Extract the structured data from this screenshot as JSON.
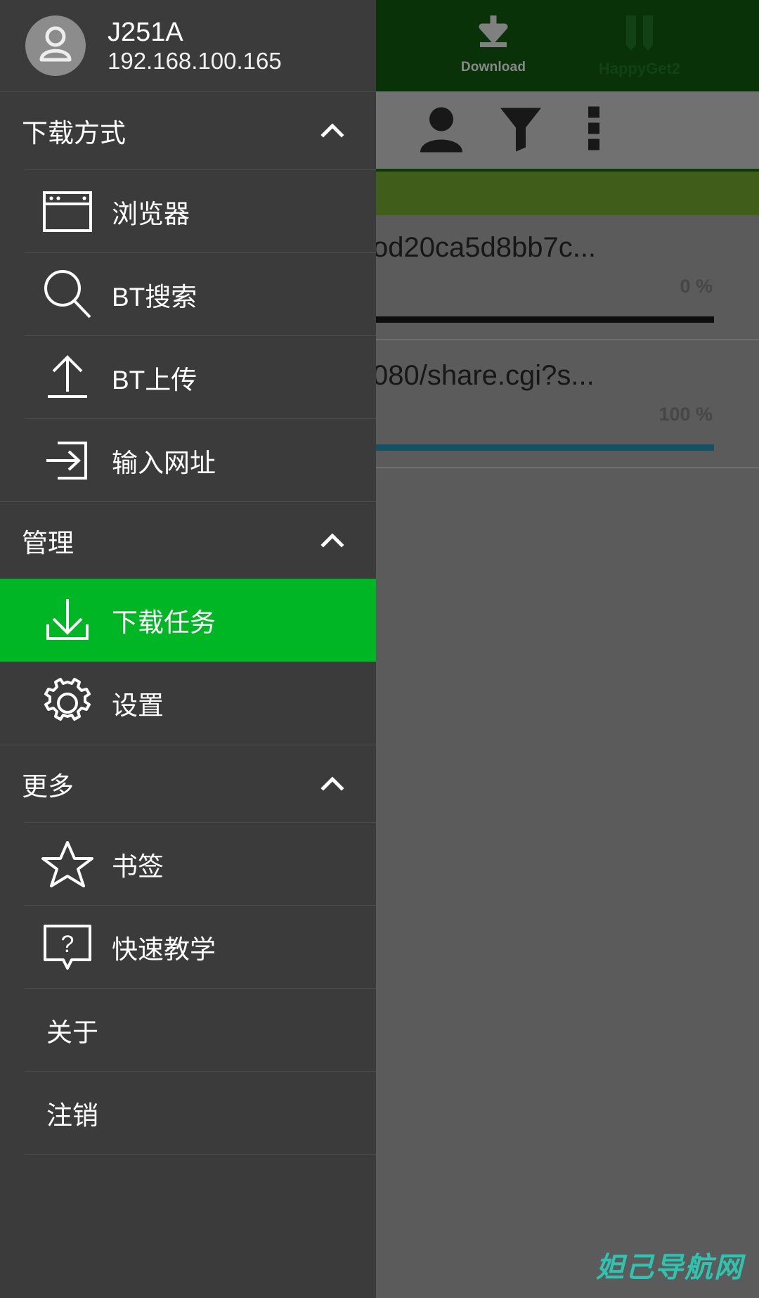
{
  "colors": {
    "accent_green": "#00b624",
    "topbar_green": "#0b3d0b",
    "band_olive": "#4f7320",
    "drawer_bg": "#3b3b3b",
    "progress_blue": "#18647a",
    "progress_empty": "#121212",
    "watermark_teal": "#2ec4b0"
  },
  "background_app": {
    "topbar": {
      "download_label": "Download",
      "download_icon": "download-arrow-icon",
      "app_name": "HappyGet2",
      "app_icon": "pause-bars-icon"
    },
    "toolbar": {
      "back_icon": "back-triangle-icon",
      "person_icon": "person-icon",
      "filter_icon": "funnel-filter-icon",
      "overflow_icon": "three-dot-menu-icon"
    },
    "download_tasks": [
      {
        "title": "od20ca5d8bb7c...",
        "percent_label": "0 %",
        "percent": 0,
        "bar_color": "#121212"
      },
      {
        "title": "080/share.cgi?s...",
        "percent_label": "100 %",
        "percent": 100,
        "bar_color": "#18647a"
      }
    ]
  },
  "drawer": {
    "header": {
      "avatar_icon": "user-avatar-icon",
      "device_name": "J251A",
      "ip_address": "192.168.100.165"
    },
    "sections": [
      {
        "title": "下载方式",
        "chevron": "chevron-up-icon",
        "items": [
          {
            "label": "浏览器",
            "icon": "browser-window-icon"
          },
          {
            "label": "BT搜索",
            "icon": "search-magnifier-icon"
          },
          {
            "label": "BT上传",
            "icon": "upload-arrow-icon"
          },
          {
            "label": "输入网址",
            "icon": "enter-url-arrow-icon"
          }
        ]
      },
      {
        "title": "管理",
        "chevron": "chevron-up-icon",
        "items": [
          {
            "label": "下载任务",
            "icon": "download-tray-icon",
            "active": true
          },
          {
            "label": "设置",
            "icon": "gear-settings-icon"
          }
        ]
      },
      {
        "title": "更多",
        "chevron": "chevron-up-icon",
        "items": [
          {
            "label": "书签",
            "icon": "star-bookmark-icon"
          },
          {
            "label": "快速教学",
            "icon": "question-bubble-icon"
          }
        ]
      }
    ],
    "footer_items": [
      {
        "label": "关于"
      },
      {
        "label": "注销"
      }
    ]
  },
  "watermark": {
    "text": "妲己导航网"
  }
}
